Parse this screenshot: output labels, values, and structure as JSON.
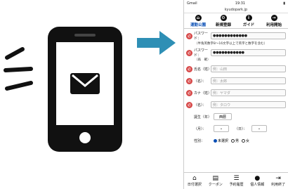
{
  "status": {
    "carrier": "Gmail",
    "time": "19:31",
    "url": "kyudopark.jp"
  },
  "topnav": [
    {
      "label": "運動公園",
      "icon": "home-icon"
    },
    {
      "label": "新規登録",
      "icon": "gear-icon"
    },
    {
      "label": "ガイド",
      "icon": "info-icon"
    },
    {
      "label": "利用開始",
      "icon": "login-icon"
    }
  ],
  "form": {
    "password_label": "パスワード：",
    "password_value": "●●●●●●●●●●●●",
    "password_note": "（半角英数字8〜16文字以上で英字と数字を含む）",
    "password_confirm_label": "パスワード：",
    "password_confirm_sub": "（再　確）",
    "password_confirm_value": "●●●●●●●●●●●",
    "last_name_label": "氏名（姓）",
    "last_name_placeholder": "例：山田",
    "first_name_label": "（名）：",
    "first_name_placeholder": "例：太郎",
    "kana_last_label": "カナ（姓）",
    "kana_last_placeholder": "例：ヤマダ",
    "kana_first_label": "（名）：",
    "kana_first_placeholder": "例：タロウ",
    "birth_label": "誕生（年）",
    "birth_year_value": "西暦",
    "month_label": "（月）：",
    "day_label": "（日）：",
    "gender_label": "性別：",
    "gender_options": [
      "未選択",
      "男",
      "女"
    ]
  },
  "bottomnav": [
    {
      "label": "日付選択",
      "icon": "home-icon"
    },
    {
      "label": "クーポン",
      "icon": "coupon-icon"
    },
    {
      "label": "予約履歴",
      "icon": "history-icon"
    },
    {
      "label": "個人情報",
      "icon": "user-icon"
    },
    {
      "label": "利用終了",
      "icon": "logout-icon"
    }
  ],
  "colors": {
    "accent": "#2e8fb5",
    "required": "#d64545",
    "active": "#0a4fb5"
  }
}
